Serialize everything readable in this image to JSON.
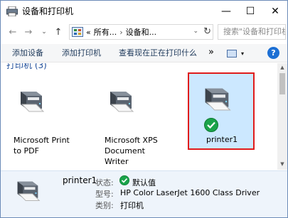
{
  "window": {
    "title": "设备和打印机",
    "controls": {
      "minimize": "—",
      "maximize": "☐",
      "close": "✕"
    }
  },
  "nav": {
    "back": "←",
    "forward": "→",
    "recent": "⌄",
    "up": "↑"
  },
  "address": {
    "prefix": "«",
    "crumbs": [
      "所有...",
      "设备和..."
    ],
    "separator": "›",
    "dropdown": "⌄",
    "refresh": "↻"
  },
  "search": {
    "placeholder": "搜索\"设备和打印机\""
  },
  "toolbar": {
    "add_device": "添加设备",
    "add_printer": "添加打印机",
    "see_printing": "查看现在正在打印什么",
    "more": "»",
    "view_dropdown": "▾",
    "help": "?"
  },
  "group": {
    "header": "打印机 (3)"
  },
  "devices": [
    {
      "name": "Microsoft Print to PDF",
      "label_lines": [
        "Microsoft Print",
        "to PDF"
      ]
    },
    {
      "name": "Microsoft XPS Document Writer",
      "label_lines": [
        "Microsoft XPS",
        "Document",
        "Writer"
      ]
    },
    {
      "name": "printer1",
      "label_lines": [
        "printer1"
      ],
      "selected": true,
      "default": true
    }
  ],
  "details": {
    "name": "printer1",
    "status_label": "状态:",
    "status_value": "默认值",
    "model_label": "型号:",
    "model_value": "HP Color LaserJet 1600 Class Driver",
    "category_label": "类别:",
    "category_value": "打印机"
  },
  "colors": {
    "selection_bg": "#cce8ff",
    "highlight_border": "#e01b1b",
    "default_check": "#1aa34a",
    "help_blue": "#1c6fd4"
  }
}
